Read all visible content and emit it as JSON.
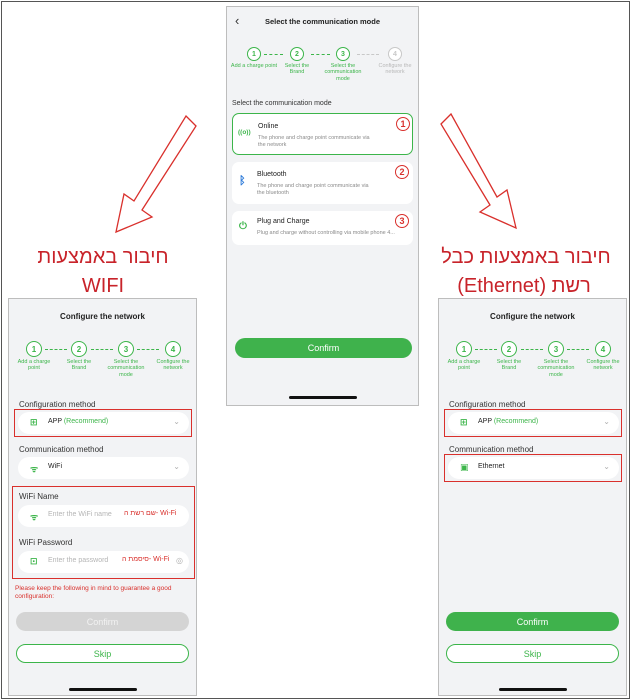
{
  "center": {
    "back_glyph": "‹",
    "title": "Select the communication mode",
    "steps": [
      {
        "num": "1",
        "label": "Add a charge point",
        "active": true
      },
      {
        "num": "2",
        "label": "Select the Brand",
        "active": true
      },
      {
        "num": "3",
        "label": "Select the communication mode",
        "active": true
      },
      {
        "num": "4",
        "label": "Configure the network",
        "active": false
      }
    ],
    "section_title": "Select the communication mode",
    "options": [
      {
        "title": "Online",
        "desc": "The phone and charge point communicate via the network",
        "badge": "1",
        "icon": "((o))"
      },
      {
        "title": "Bluetooth",
        "desc": "The phone and charge point communicate via the bluetooth",
        "badge": "2",
        "icon": "ᛒ"
      },
      {
        "title": "Plug and Charge",
        "desc": "Plug and charge without controlling via mobile phone 4...",
        "badge": "3",
        "icon": "⏻"
      }
    ],
    "confirm_label": "Confirm"
  },
  "left": {
    "title": "Configure the network",
    "steps": [
      {
        "num": "1",
        "label": "Add a charge point"
      },
      {
        "num": "2",
        "label": "Select the Brand"
      },
      {
        "num": "3",
        "label": "Select the communication mode"
      },
      {
        "num": "4",
        "label": "Configure the network"
      }
    ],
    "config_label": "Configuration method",
    "config_value": "APP",
    "config_recommend": "(Recommend)",
    "comm_label": "Communication method",
    "comm_value": "WiFi",
    "wifi_name_label": "WiFi Name",
    "wifi_name_placeholder": "Enter the WiFi name",
    "wifi_name_note": "שם רשת ה- Wi-Fi",
    "wifi_pwd_label": "WiFi Password",
    "wifi_pwd_placeholder": "Enter the password",
    "wifi_pwd_note": "סיסמת ה- Wi-Fi",
    "warning": "Please keep the following in mind to guarantee a good configuration:",
    "confirm_label": "Confirm",
    "skip_label": "Skip"
  },
  "right": {
    "title": "Configure the network",
    "steps": [
      {
        "num": "1",
        "label": "Add a charge point"
      },
      {
        "num": "2",
        "label": "Select the Brand"
      },
      {
        "num": "3",
        "label": "Select the communication mode"
      },
      {
        "num": "4",
        "label": "Configure the network"
      }
    ],
    "config_label": "Configuration method",
    "config_value": "APP",
    "config_recommend": "(Recommend)",
    "comm_label": "Communication method",
    "comm_value": "Ethernet",
    "confirm_label": "Confirm",
    "skip_label": "Skip"
  },
  "annotations": {
    "left_line1": "חיבור באמצעות",
    "left_line2": "WIFI",
    "right_line1": "חיבור באמצעות כבל",
    "right_line2": "רשת (Ethernet)"
  },
  "colors": {
    "accent": "#3cb54a",
    "annotation": "#d9302c",
    "background": "#f2f3f5"
  }
}
